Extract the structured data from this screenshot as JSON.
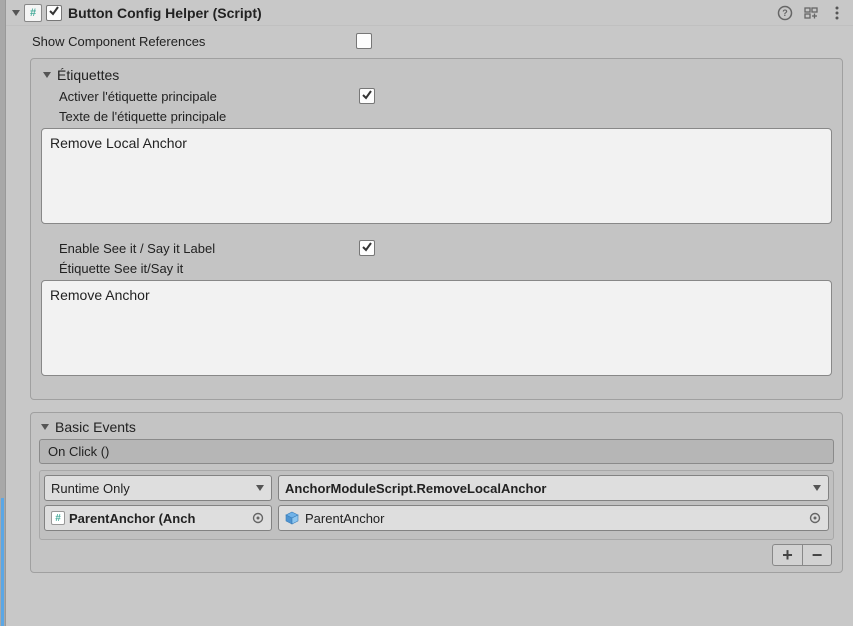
{
  "header": {
    "title": "Button Config Helper (Script)",
    "script_icon_glyph": "#",
    "enabled": true
  },
  "show_refs": {
    "label": "Show Component References",
    "checked": false
  },
  "etiquettes": {
    "title": "Étiquettes",
    "activer": {
      "label": "Activer l'étiquette principale",
      "checked": true
    },
    "texte_label": "Texte de l'étiquette principale",
    "texte_value": "Remove Local Anchor",
    "enable_seeit": {
      "label": "Enable See it / Say it Label",
      "checked": true
    },
    "seeit_label": "Étiquette See it/Say it",
    "seeit_value": "Remove Anchor"
  },
  "events": {
    "title": "Basic Events",
    "onclick_label": "On Click ()",
    "rows": [
      {
        "call_state": "Runtime Only",
        "method": "AnchorModuleScript.RemoveLocalAnchor",
        "target_display": "ParentAnchor (Anch",
        "argument": "ParentAnchor"
      }
    ],
    "add_glyph": "+",
    "remove_glyph": "−"
  }
}
